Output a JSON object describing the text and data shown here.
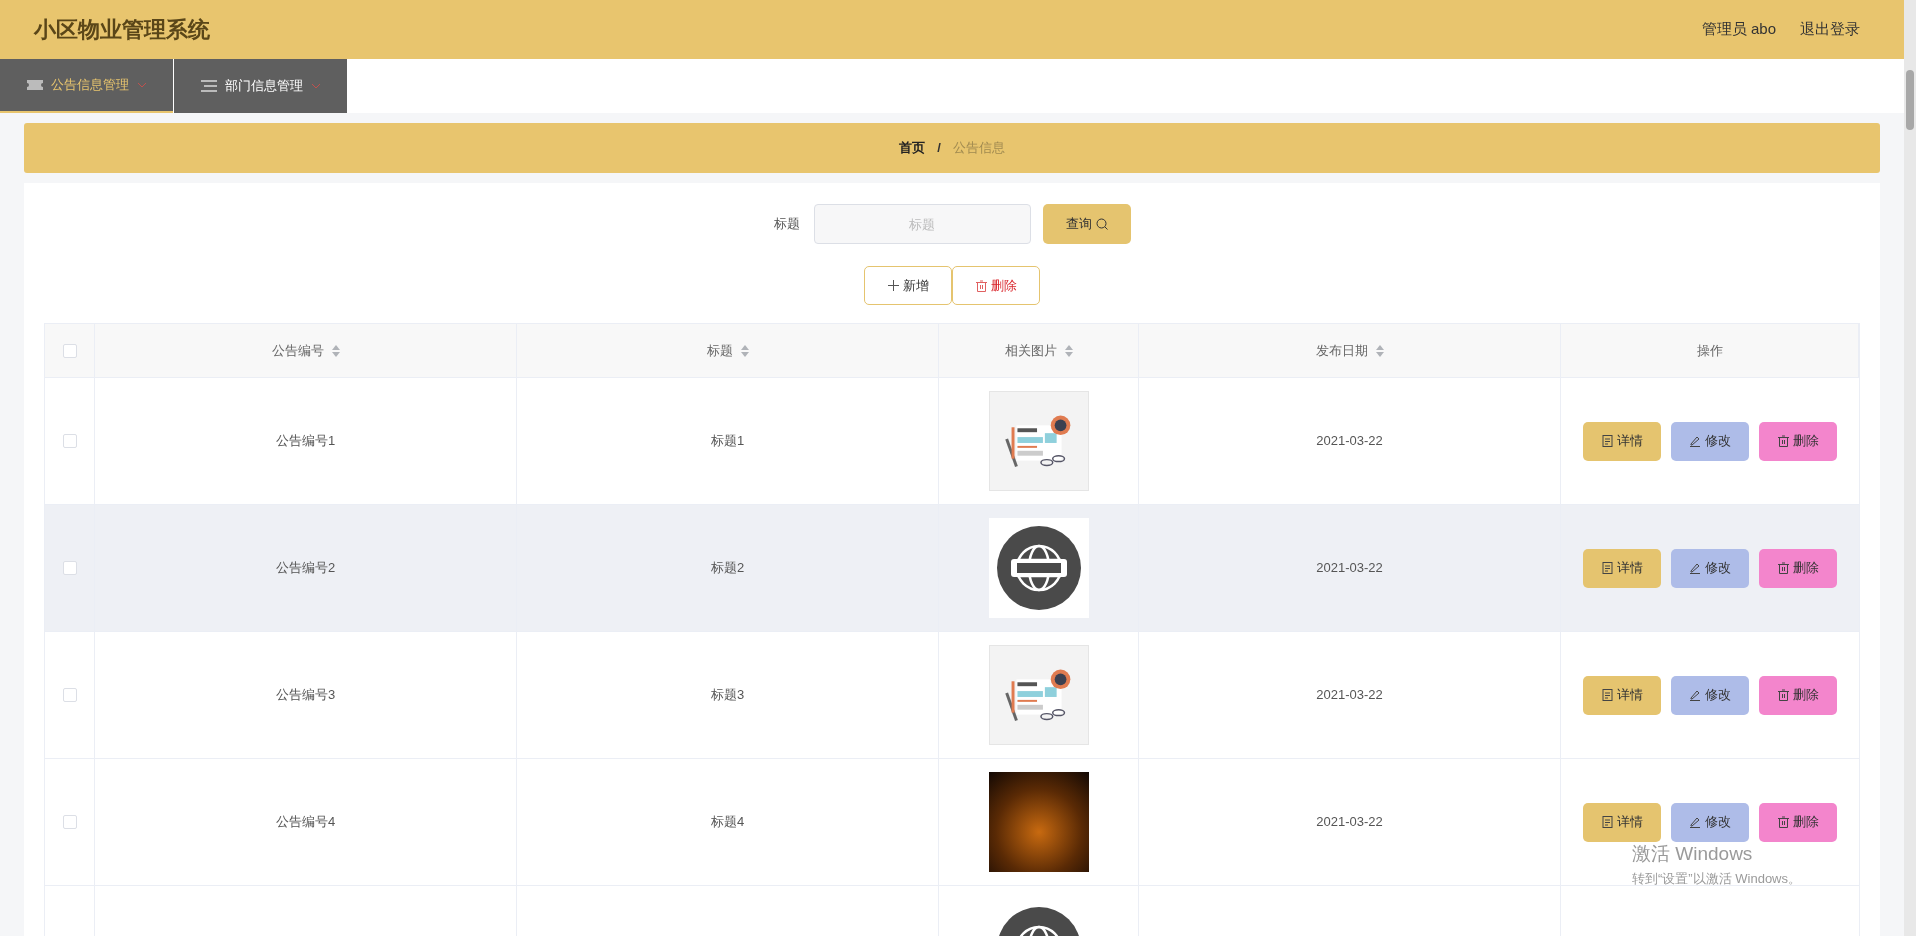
{
  "header": {
    "title": "小区物业管理系统",
    "user": "管理员 abo",
    "logout": "退出登录"
  },
  "nav": [
    {
      "label": "公告信息管理",
      "selected": true
    },
    {
      "label": "部门信息管理",
      "selected": false
    }
  ],
  "breadcrumb": [
    {
      "label": "首页",
      "current": false
    },
    {
      "label": "公告信息",
      "current": true
    }
  ],
  "breadcrumb_separator": "/",
  "search": {
    "label": "标题",
    "placeholder": "标题",
    "button": "查询"
  },
  "actions": [
    {
      "kind": "add",
      "label": "新增"
    },
    {
      "kind": "delete",
      "label": "删除"
    }
  ],
  "table": {
    "select_all_checked": false,
    "columns": [
      {
        "label": "公告编号",
        "sortable": true
      },
      {
        "label": "标题",
        "sortable": true
      },
      {
        "label": "相关图片",
        "sortable": true
      },
      {
        "label": "发布日期",
        "sortable": true
      },
      {
        "label": "操作",
        "sortable": false
      }
    ],
    "rows": [
      {
        "number": "公告编号1",
        "title": "标题1",
        "date": "2021-03-22",
        "checked": false,
        "hovered": false,
        "buttons": [
          {
            "kind": "detail",
            "label": "详情"
          },
          {
            "kind": "edit",
            "label": "修改"
          },
          {
            "kind": "delete",
            "label": "删除"
          }
        ]
      },
      {
        "number": "公告编号2",
        "title": "标题2",
        "date": "2021-03-22",
        "checked": false,
        "hovered": true,
        "buttons": [
          {
            "kind": "detail",
            "label": "详情"
          },
          {
            "kind": "edit",
            "label": "修改"
          },
          {
            "kind": "delete",
            "label": "删除"
          }
        ]
      },
      {
        "number": "公告编号3",
        "title": "标题3",
        "date": "2021-03-22",
        "checked": false,
        "hovered": false,
        "buttons": [
          {
            "kind": "detail",
            "label": "详情"
          },
          {
            "kind": "edit",
            "label": "修改"
          },
          {
            "kind": "delete",
            "label": "删除"
          }
        ]
      },
      {
        "number": "公告编号4",
        "title": "标题4",
        "date": "2021-03-22",
        "checked": false,
        "hovered": false,
        "buttons": [
          {
            "kind": "detail",
            "label": "详情"
          },
          {
            "kind": "edit",
            "label": "修改"
          },
          {
            "kind": "delete",
            "label": "删除"
          }
        ]
      },
      {
        "hovered": false
      }
    ]
  },
  "system_notice": {
    "title": "激活 Windows",
    "text": "转到“设置”以激活 Windows。"
  }
}
